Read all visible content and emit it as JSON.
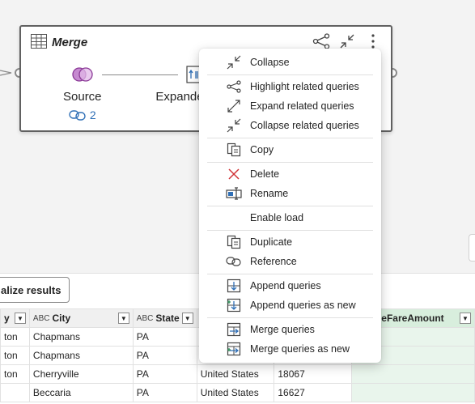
{
  "query": {
    "title": "Merge",
    "steps": [
      {
        "label": "Source",
        "link_count": "2"
      },
      {
        "label": "Expande"
      }
    ]
  },
  "toolbar": {
    "visualize_label": "alize results"
  },
  "grid": {
    "headers": [
      {
        "label": "y",
        "type": ""
      },
      {
        "label": "City",
        "type": "ABC"
      },
      {
        "label": "State",
        "type": "ABC"
      },
      {
        "label": "",
        "type": ""
      },
      {
        "label": "",
        "type": ""
      },
      {
        "label": "verageFareAmount",
        "type": ""
      }
    ],
    "rows": [
      [
        "ton",
        "Chapmans",
        "PA",
        "",
        "",
        ""
      ],
      [
        "ton",
        "Chapmans",
        "PA",
        "",
        "",
        ""
      ],
      [
        "ton",
        "Cherryville",
        "PA",
        "United States",
        "18067",
        ""
      ],
      [
        "",
        "Beccaria",
        "PA",
        "United States",
        "16627",
        ""
      ]
    ]
  },
  "menu": {
    "groups": [
      [
        {
          "label": "Collapse",
          "icon": "collapse-icon"
        }
      ],
      [
        {
          "label": "Highlight related queries",
          "icon": "share-icon"
        },
        {
          "label": "Expand related queries",
          "icon": "expand-icon"
        },
        {
          "label": "Collapse related queries",
          "icon": "collapse-icon"
        }
      ],
      [
        {
          "label": "Copy",
          "icon": "copy-icon"
        }
      ],
      [
        {
          "label": "Delete",
          "icon": "delete-icon"
        },
        {
          "label": "Rename",
          "icon": "rename-icon"
        }
      ],
      [
        {
          "label": "Enable load",
          "icon": ""
        }
      ],
      [
        {
          "label": "Duplicate",
          "icon": "duplicate-icon"
        },
        {
          "label": "Reference",
          "icon": "reference-icon"
        }
      ],
      [
        {
          "label": "Append queries",
          "icon": "append-icon"
        },
        {
          "label": "Append queries as new",
          "icon": "append-new-icon"
        }
      ],
      [
        {
          "label": "Merge queries",
          "icon": "merge-icon"
        },
        {
          "label": "Merge queries as new",
          "icon": "merge-new-icon"
        }
      ]
    ]
  },
  "colors": {
    "accent": "#2f6fb6",
    "delete": "#d13438",
    "highlight": "#d8eedd"
  }
}
